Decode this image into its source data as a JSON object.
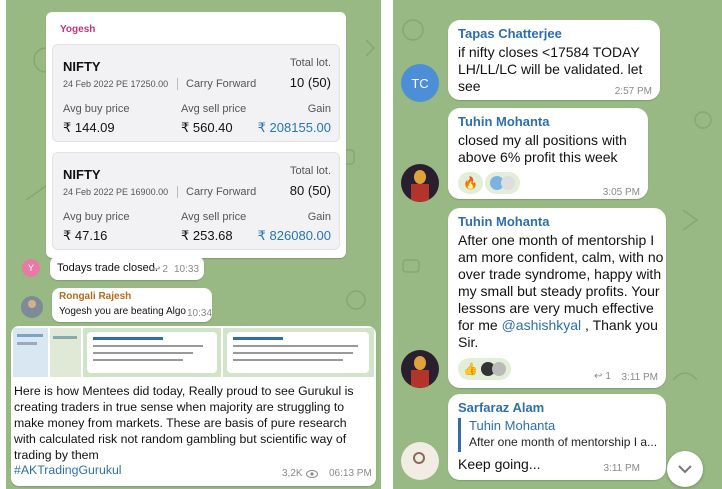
{
  "left": {
    "card_sender": "Yogesh",
    "positions": [
      {
        "symbol": "NIFTY",
        "detail": "24 Feb 2022 PE 17250.00",
        "type": "Carry Forward",
        "total_label": "Total lot.",
        "total": "10 (50)",
        "avg_buy_label": "Avg buy price",
        "avg_buy": "₹ 144.09",
        "avg_sell_label": "Avg sell price",
        "avg_sell": "₹ 560.40",
        "gain_label": "Gain",
        "gain": "₹ 208155.00"
      },
      {
        "symbol": "NIFTY",
        "detail": "24 Feb 2022 PE 16900.00",
        "type": "Carry Forward",
        "total_label": "Total lot.",
        "total": "80 (50)",
        "avg_buy_label": "Avg buy price",
        "avg_buy": "₹ 47.16",
        "avg_sell_label": "Avg sell price",
        "avg_sell": "₹ 253.68",
        "gain_label": "Gain",
        "gain": "₹ 826080.00"
      }
    ],
    "msg_closed": {
      "avatar_letter": "Y",
      "text": "Todays trade closed.",
      "replies": "2",
      "time": "10:33"
    },
    "msg_rongali": {
      "name": "Rongali Rajesh",
      "text": "Yogesh you are beating Algo",
      "time": "10:34"
    },
    "main_post": {
      "text": "Here is how Mentees did today, Really proud to see Gurukul is creating traders in true sense when majority are struggling to make money from markets. These are basis of pure research with calculated risk not random gambling but scientific way of trading by them",
      "hashtag": "#AKTradingGurukul",
      "views": "3,2K",
      "time": "06:13 PM"
    }
  },
  "right": {
    "msgs": [
      {
        "name": "Tapas Chatterjee",
        "avatar": "TC",
        "text": "if nifty closes <17584 TODAY LH/LL/LC will be validated. let see",
        "time": "2:57 PM"
      },
      {
        "name": "Tuhin Mohanta",
        "text": "closed my all positions with above 6% profit this week",
        "time": "3:05 PM"
      },
      {
        "name": "Tuhin Mohanta",
        "text": "After one month of mentorship I am more confident, calm, with no over trade syndrome, happy with my small but steady profits. Your lessons are very much effective for me",
        "mention": "@ashishkyal",
        "text_end": ", Thank you Sir.",
        "replies": "1",
        "time": "3:11 PM"
      },
      {
        "name": "Sarfaraz Alam",
        "quote_name": "Tuhin Mohanta",
        "quote_text": "After one month of mentorship I a...",
        "text": "Keep going...",
        "time": "3:11 PM"
      }
    ]
  },
  "colors": {
    "chat_bg": "#98b884",
    "name_blue": "#2e6fa9",
    "gain_blue": "#2477b4",
    "tc_avatar": "#4c8fd6",
    "yogesh_pink": "#c0357a"
  },
  "icons": [
    "reply-icon",
    "eye-icon",
    "scroll-down-icon",
    "fire-emoji",
    "thumbs-up-emoji"
  ]
}
